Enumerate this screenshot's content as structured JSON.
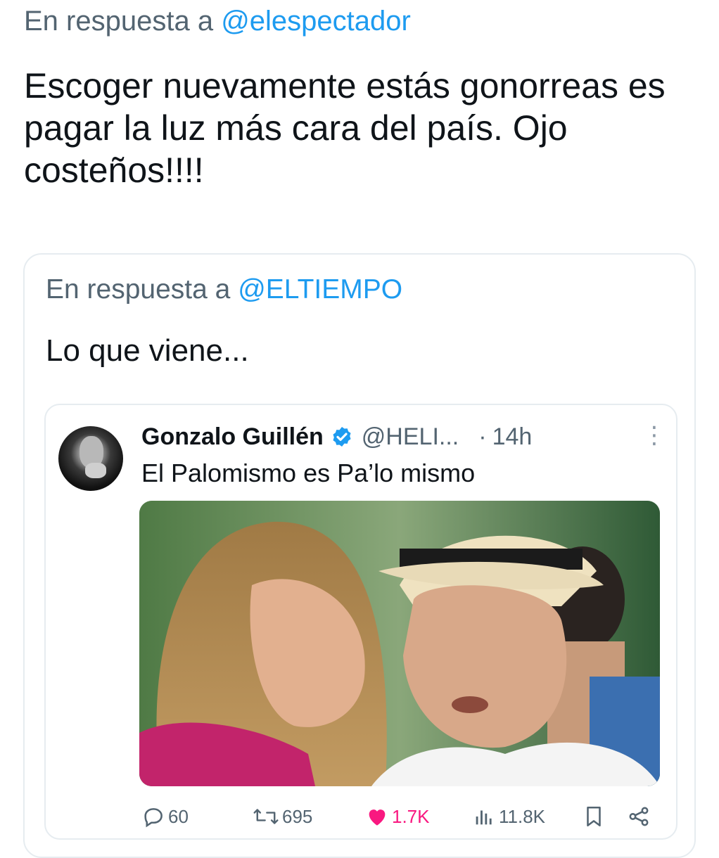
{
  "reply": {
    "prefix": "En respuesta a",
    "handle": "@elespectador"
  },
  "main_text": "Escoger nuevamente estás gonorreas es pagar la luz más cara del país. Ojo costeños!!!!",
  "quote": {
    "reply_prefix": "En respuesta a",
    "reply_handle": "@ELTIEMPO",
    "text": "Lo que viene..."
  },
  "inner_tweet": {
    "author_name": "Gonzalo Guillén",
    "author_handle": "@HELI...",
    "dot": "·",
    "time": "14h",
    "text": "El Palomismo es Pa’lo mismo",
    "stats": {
      "replies": "60",
      "reposts": "695",
      "likes": "1.7K",
      "views": "11.8K"
    }
  },
  "colors": {
    "link": "#1d9bf0",
    "muted": "#536471",
    "like": "#f91880"
  },
  "icons": [
    "verified-badge-icon",
    "more-options-icon",
    "reply-icon",
    "repost-icon",
    "like-icon",
    "views-icon",
    "bookmark-icon",
    "share-icon"
  ]
}
